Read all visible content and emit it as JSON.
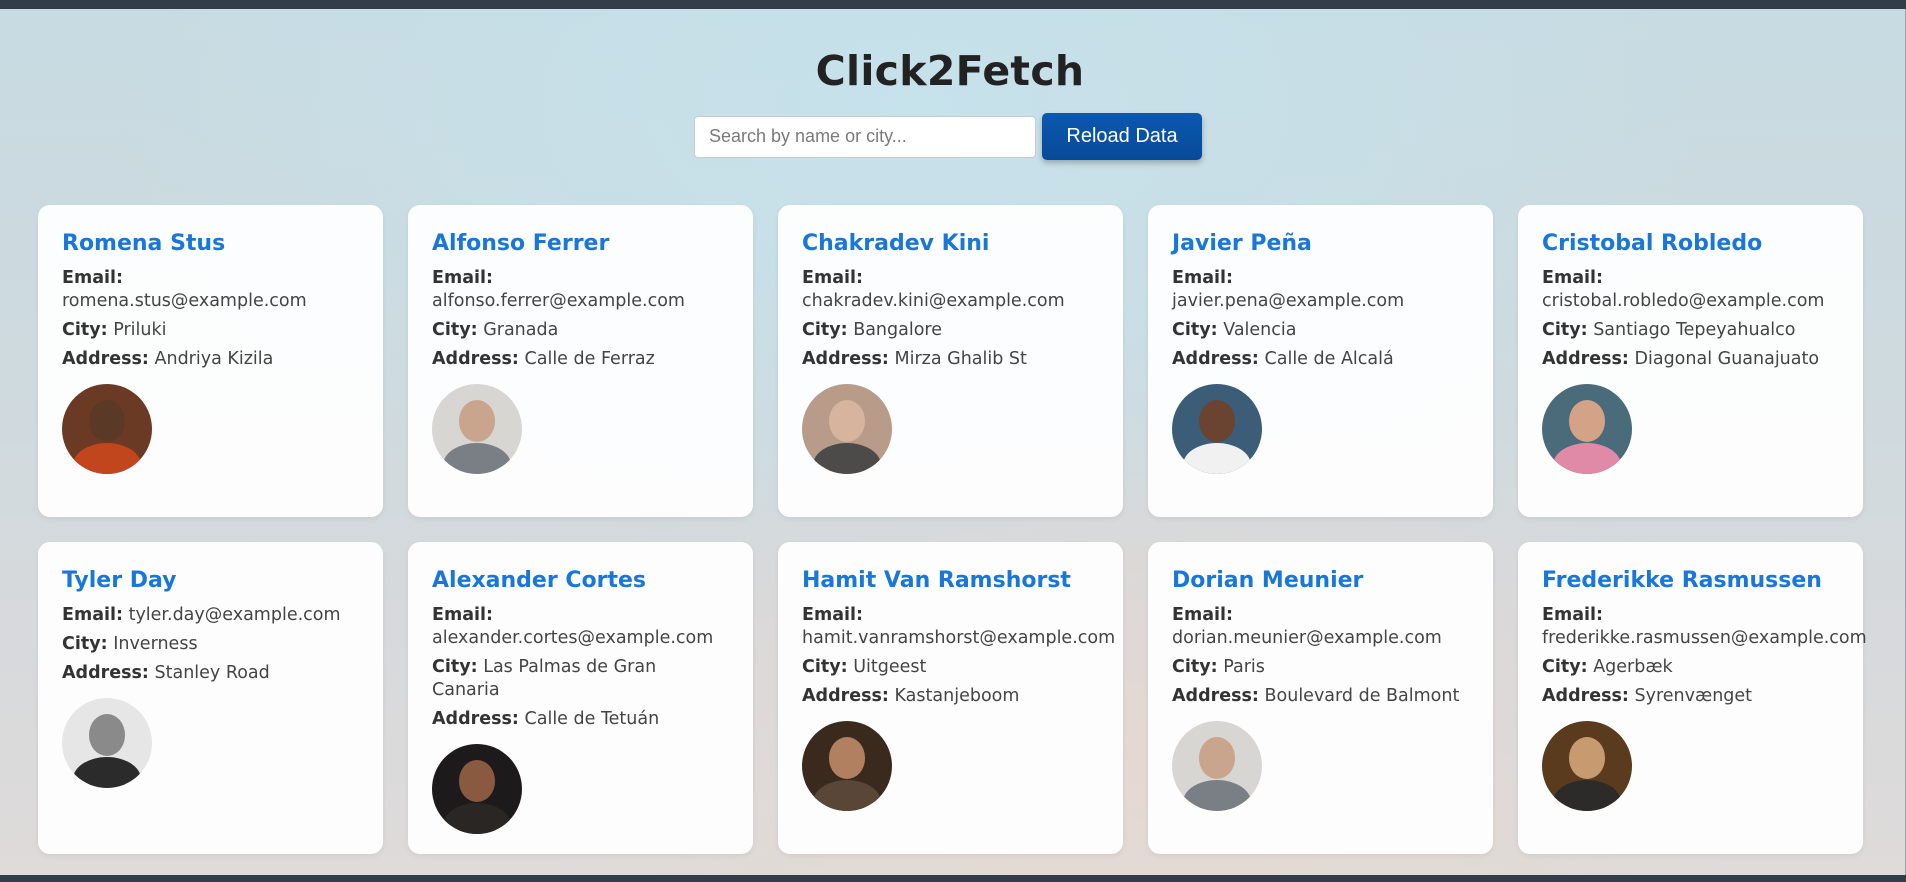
{
  "app": {
    "title": "Click2Fetch",
    "search_placeholder": "Search by name or city...",
    "reload_label": "Reload Data"
  },
  "labels": {
    "email": "Email:",
    "city": "City:",
    "address": "Address:"
  },
  "users": [
    {
      "name": "Romena Stus",
      "email": "romena.stus@example.com",
      "city": "Priluki",
      "address": "Andriya Kizila",
      "avatar": {
        "bg": "#6b3a24",
        "skin": "#5a3a26",
        "shirt": "#c2461d"
      }
    },
    {
      "name": "Alfonso Ferrer",
      "email": "alfonso.ferrer@example.com",
      "city": "Granada",
      "address": "Calle de Ferraz",
      "avatar": {
        "bg": "#d8d6d2",
        "skin": "#c9a58e",
        "shirt": "#7a7f86"
      }
    },
    {
      "name": "Chakradev Kini",
      "email": "chakradev.kini@example.com",
      "city": "Bangalore",
      "address": "Mirza Ghalib St",
      "avatar": {
        "bg": "#b89b88",
        "skin": "#d7b49d",
        "shirt": "#4d4a4a"
      }
    },
    {
      "name": "Javier Peña",
      "email": "javier.pena@example.com",
      "city": "Valencia",
      "address": "Calle de Alcalá",
      "avatar": {
        "bg": "#3b5d78",
        "skin": "#6a4430",
        "shirt": "#f1f1f1"
      }
    },
    {
      "name": "Cristobal Robledo",
      "email": "cristobal.robledo@example.com",
      "city": "Santiago Tepeyahualco",
      "address": "Diagonal Guanajuato",
      "avatar": {
        "bg": "#4a6b7a",
        "skin": "#d3a287",
        "shirt": "#e08aa8"
      }
    },
    {
      "name": "Tyler Day",
      "email": "tyler.day@example.com",
      "city": "Inverness",
      "address": "Stanley Road",
      "avatar": {
        "bg": "#e6e6e6",
        "skin": "#8a8a8a",
        "shirt": "#2b2b2b"
      }
    },
    {
      "name": "Alexander Cortes",
      "email": "alexander.cortes@example.com",
      "city": "Las Palmas de Gran Canaria",
      "address": "Calle de Tetuán",
      "avatar": {
        "bg": "#1c1a1a",
        "skin": "#8a5a40",
        "shirt": "#2a2624"
      }
    },
    {
      "name": "Hamit Van Ramshorst",
      "email": "hamit.vanramshorst@example.com",
      "city": "Uitgeest",
      "address": "Kastanjeboom",
      "avatar": {
        "bg": "#3a2a1e",
        "skin": "#b08060",
        "shirt": "#5a4636"
      }
    },
    {
      "name": "Dorian Meunier",
      "email": "dorian.meunier@example.com",
      "city": "Paris",
      "address": "Boulevard de Balmont",
      "avatar": {
        "bg": "#d8d6d2",
        "skin": "#c9a58e",
        "shirt": "#7a7f86"
      }
    },
    {
      "name": "Frederikke Rasmussen",
      "email": "frederikke.rasmussen@example.com",
      "city": "Agerbæk",
      "address": "Syrenvænget",
      "avatar": {
        "bg": "#5a3b1e",
        "skin": "#c89a70",
        "shirt": "#2c2b2a"
      }
    }
  ]
}
